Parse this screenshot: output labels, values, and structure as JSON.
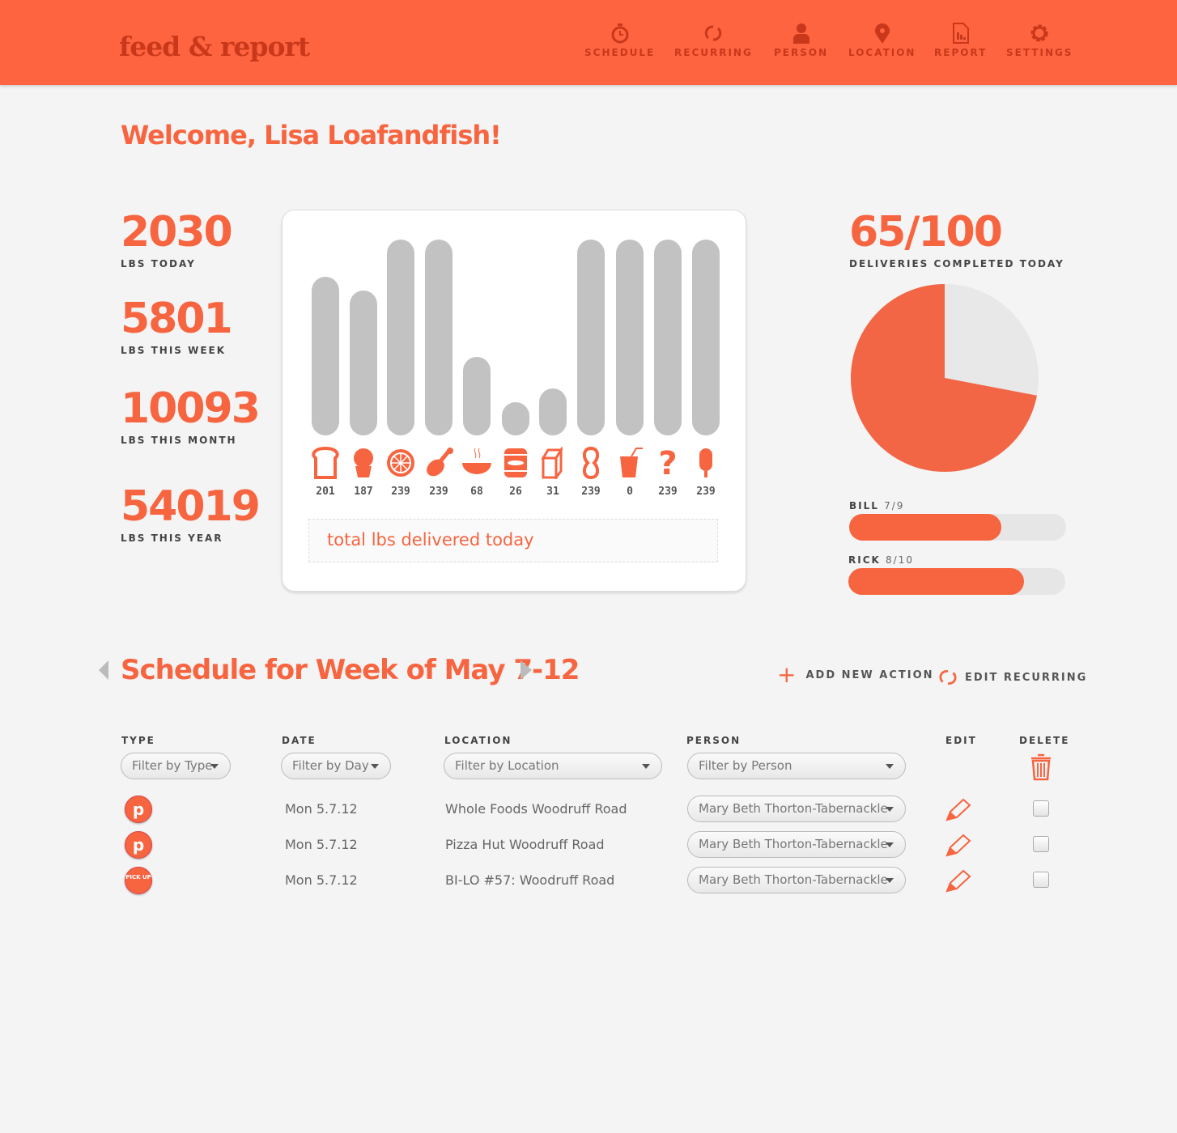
{
  "header": {
    "logo": "feed & report",
    "nav": [
      {
        "label": "SCHEDULE",
        "icon": "stopwatch-icon"
      },
      {
        "label": "RECURRING",
        "icon": "recurring-icon"
      },
      {
        "label": "PERSON",
        "icon": "person-icon"
      },
      {
        "label": "LOCATION",
        "icon": "location-pin-icon"
      },
      {
        "label": "REPORT",
        "icon": "report-icon"
      },
      {
        "label": "SETTINGS",
        "icon": "gear-icon"
      }
    ]
  },
  "colors": {
    "accent": "#f76440",
    "header": "#ff6440",
    "bar": "#c2c2c2"
  },
  "welcome": "Welcome, Lisa Loafandfish!",
  "stats": [
    {
      "value": "2030",
      "label": "LBS TODAY"
    },
    {
      "value": "5801",
      "label": "LBS THIS WEEK"
    },
    {
      "value": "10093",
      "label": "LBS THIS MONTH"
    },
    {
      "value": "54019",
      "label": "LBS THIS YEAR"
    }
  ],
  "food_chart": {
    "items": [
      {
        "icon": "bread-icon",
        "value": "201",
        "level": 0.81
      },
      {
        "icon": "cupcake-icon",
        "value": "187",
        "level": 0.74
      },
      {
        "icon": "orange-icon",
        "value": "239",
        "level": 1
      },
      {
        "icon": "chicken-leg-icon",
        "value": "239",
        "level": 1
      },
      {
        "icon": "soup-bowl-icon",
        "value": "68",
        "level": 0.4
      },
      {
        "icon": "can-icon",
        "value": "26",
        "level": 0.17
      },
      {
        "icon": "milk-carton-icon",
        "value": "31",
        "level": 0.24
      },
      {
        "icon": "peanut-icon",
        "value": "239",
        "level": 1
      },
      {
        "icon": "drink-cup-icon",
        "value": "0",
        "level": 1
      },
      {
        "icon": "question-mark-icon",
        "value": "239",
        "level": 1
      },
      {
        "icon": "popsicle-icon",
        "value": "239",
        "level": 1
      }
    ],
    "caption": "total lbs delivered today"
  },
  "deliveries": {
    "value": "65/100",
    "label": "DELIVERIES COMPLETED TODAY",
    "pie_completed_fraction": 0.72,
    "drivers": [
      {
        "name": "BILL",
        "count": "7/9",
        "progress": 0.7
      },
      {
        "name": "RICK",
        "count": "8/10",
        "progress": 0.81
      }
    ]
  },
  "schedule": {
    "title": "Schedule for Week of May 7-12",
    "add_action": "ADD NEW ACTION",
    "edit_recurring": "EDIT RECURRING",
    "columns": [
      "TYPE",
      "DATE",
      "LOCATION",
      "PERSON",
      "EDIT",
      "DELETE"
    ],
    "filters": {
      "type": "Filter by Type",
      "day": "Filter by Day",
      "location": "Filter by Location",
      "person": "Filter by Person"
    },
    "rows": [
      {
        "type_badge": "p",
        "date": "Mon 5.7.12",
        "location": "Whole Foods Woodruff Road",
        "person": "Mary Beth Thorton-Tabernackle"
      },
      {
        "type_badge": "p",
        "date": "Mon 5.7.12",
        "location": "Pizza Hut Woodruff Road",
        "person": "Mary Beth Thorton-Tabernackle"
      },
      {
        "type_badge": "PICK UP",
        "date": "Mon 5.7.12",
        "location": "BI-LO #57: Woodruff Road",
        "person": "Mary Beth Thorton-Tabernackle"
      }
    ]
  }
}
